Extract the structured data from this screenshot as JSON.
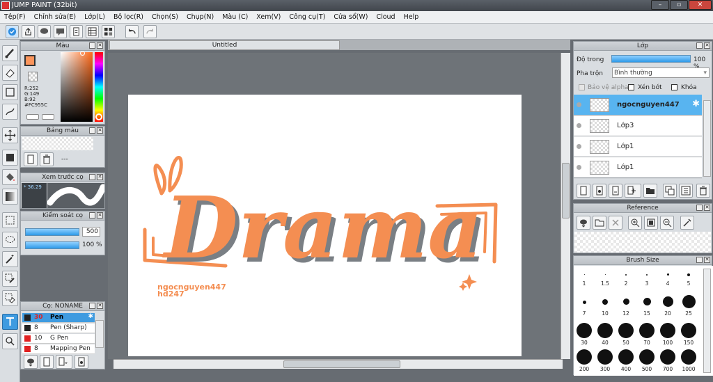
{
  "title": "JUMP PAINT (32bit)",
  "menu": [
    "Tệp(F)",
    "Chỉnh sửa(E)",
    "Lớp(L)",
    "Bộ lọc(R)",
    "Chọn(S)",
    "Chụp(N)",
    "Màu (C)",
    "Xem(V)",
    "Công cụ(T)",
    "Cửa sổ(W)",
    "Cloud",
    "Help"
  ],
  "color_panel": {
    "title": "Màu",
    "r": "R:252",
    "g": "G:149",
    "b": "B:92",
    "hex": "#FC955C",
    "swatch": "#fc955c"
  },
  "palette_panel": {
    "title": "Bảng màu",
    "value": "---"
  },
  "preview_panel": {
    "title": "Xem trước cọ",
    "size": "36.29"
  },
  "brush_control": {
    "title": "Kiểm soát cọ",
    "size": "500",
    "opacity": "100 %"
  },
  "brush_list": {
    "title": "Cọ: NONAME",
    "items": [
      {
        "size": "30",
        "name": "Pen",
        "color": "#222222"
      },
      {
        "size": "8",
        "name": "Pen (Sharp)",
        "color": "#222222"
      },
      {
        "size": "10",
        "name": "G Pen",
        "color": "#e02020"
      },
      {
        "size": "8",
        "name": "Mapping Pen",
        "color": "#e02020"
      }
    ]
  },
  "canvas": {
    "tab": "Untitled",
    "word": "Drama",
    "credit1": "ngocnguyen447",
    "credit2": "hd247",
    "ink": "#f48e52",
    "shadow": "#7a7f84"
  },
  "layer_panel": {
    "title": "Lớp",
    "opacity_label": "Độ trong",
    "opacity": "100 %",
    "blend_label": "Pha trộn",
    "blend": "Bình thường",
    "alpha_label": "Bảo vệ alpha",
    "clip_label": "Xén bớt",
    "lock_label": "Khóa",
    "layers": [
      "ngocnguyen447",
      "Lớp3",
      "Lớp1",
      "Lớp1"
    ]
  },
  "reference_panel": {
    "title": "Reference"
  },
  "brush_size": {
    "title": "Brush Size",
    "sizes": [
      "1",
      "1.5",
      "2",
      "3",
      "4",
      "5",
      "7",
      "10",
      "12",
      "15",
      "20",
      "25",
      "30",
      "40",
      "50",
      "70",
      "100",
      "150",
      "200",
      "300",
      "400",
      "500",
      "700",
      "1000"
    ]
  }
}
